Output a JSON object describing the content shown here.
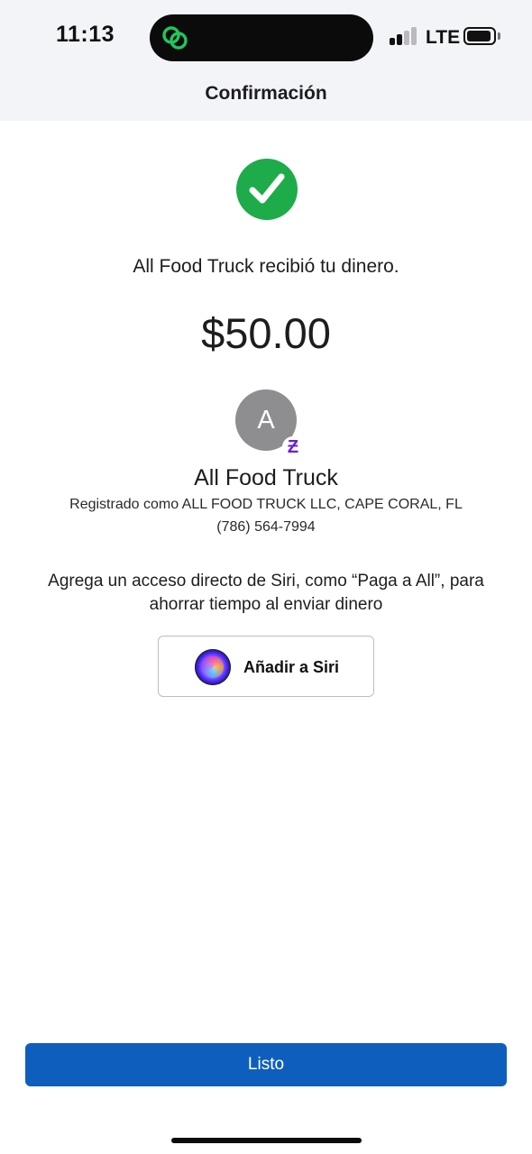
{
  "status_bar": {
    "time": "11:13",
    "network": "LTE",
    "island_icon": "zelle-link-icon",
    "signal_bars_active": 2,
    "signal_bars_total": 4
  },
  "header": {
    "title": "Confirmación"
  },
  "confirmation": {
    "success_icon": "checkmark-circle-icon",
    "message": "All Food Truck recibió tu dinero.",
    "amount": "$50.00",
    "accent_color": "#1eab49"
  },
  "recipient": {
    "avatar_initial": "A",
    "badge_glyph": "Ƶ",
    "badge_icon": "zelle-badge-icon",
    "name": "All Food Truck",
    "registered_as": "Registrado como ALL FOOD TRUCK LLC, CAPE CORAL, FL",
    "phone": "(786) 564-7994"
  },
  "siri": {
    "prompt": "Agrega un acceso directo de Siri, como “Paga a All”, para ahorrar tiempo al enviar dinero",
    "button_label": "Añadir a Siri",
    "icon": "siri-icon"
  },
  "footer": {
    "done_label": "Listo",
    "button_color": "#0e5fbd"
  }
}
